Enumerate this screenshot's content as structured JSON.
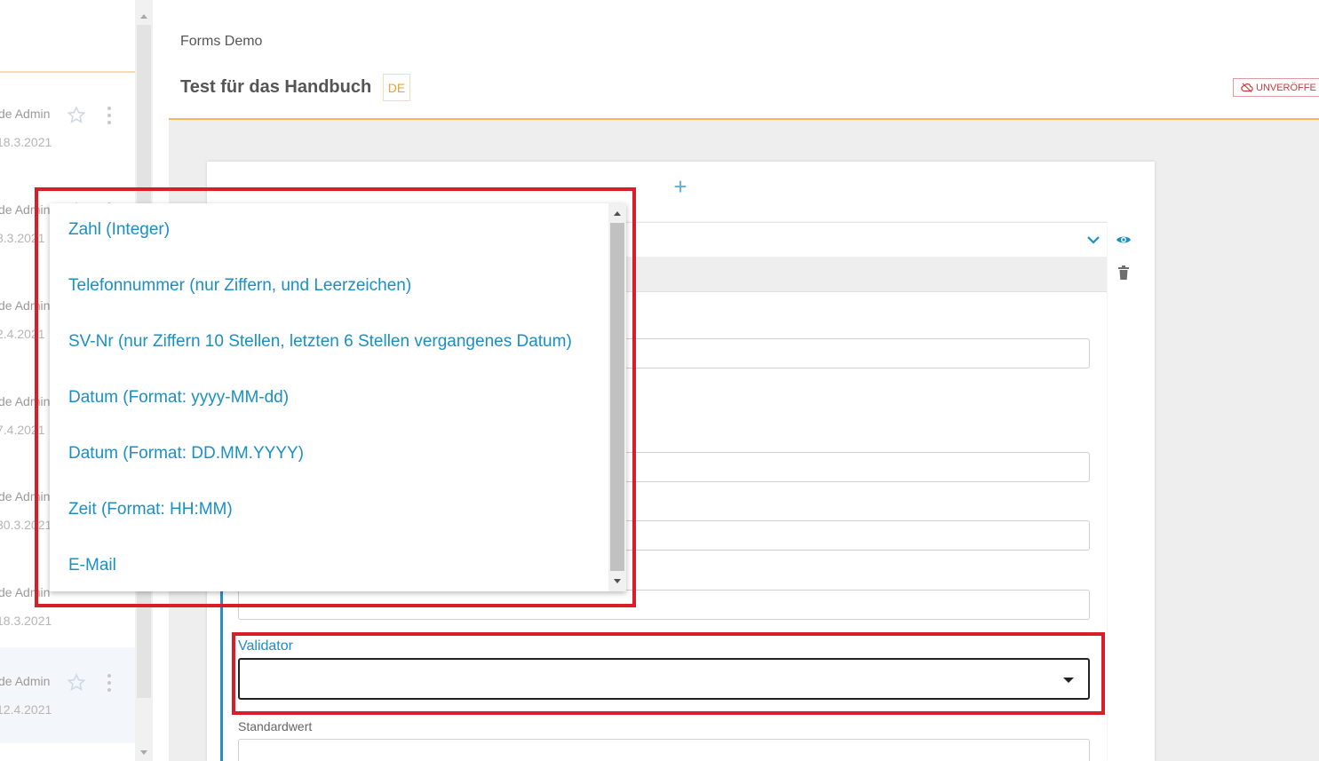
{
  "header": {
    "breadcrumb": "Forms Demo",
    "title": "Test für das Handbuch",
    "language_badge": "DE",
    "status_badge": "UNVERÖFFE"
  },
  "sidebar": {
    "items": [
      {
        "author": "de Admin",
        "date": "18.3.2021",
        "selected": false
      },
      {
        "author": "de Admin",
        "date": "8.3.2021",
        "selected": false
      },
      {
        "author": "de Admin",
        "date": "2.4.2021",
        "selected": false
      },
      {
        "author": "de Admin",
        "date": "7.4.2021",
        "selected": false
      },
      {
        "author": "de Admin",
        "date": "30.3.2021",
        "selected": false
      },
      {
        "author": "de Admin",
        "date": "18.3.2021",
        "selected": false
      },
      {
        "author": "de Admin",
        "date": "12.4.2021",
        "selected": true
      }
    ]
  },
  "editor": {
    "add_symbol": "+",
    "validator_label": "Validator",
    "validator_value": "",
    "default_value_label": "Standardwert"
  },
  "dropdown": {
    "options": [
      "Zahl (Integer)",
      "Telefonnummer (nur Ziffern, und Leerzeichen)",
      "SV-Nr (nur Ziffern 10 Stellen, letzten 6 Stellen vergangenes Datum)",
      "Datum (Format: yyyy-MM-dd)",
      "Datum (Format: DD.MM.YYYY)",
      "Zeit (Format: HH:MM)",
      "E-Mail"
    ]
  },
  "colors": {
    "accent_orange": "#f3b760",
    "link_blue": "#1a8fc4",
    "highlight_red": "#d91e2a"
  }
}
